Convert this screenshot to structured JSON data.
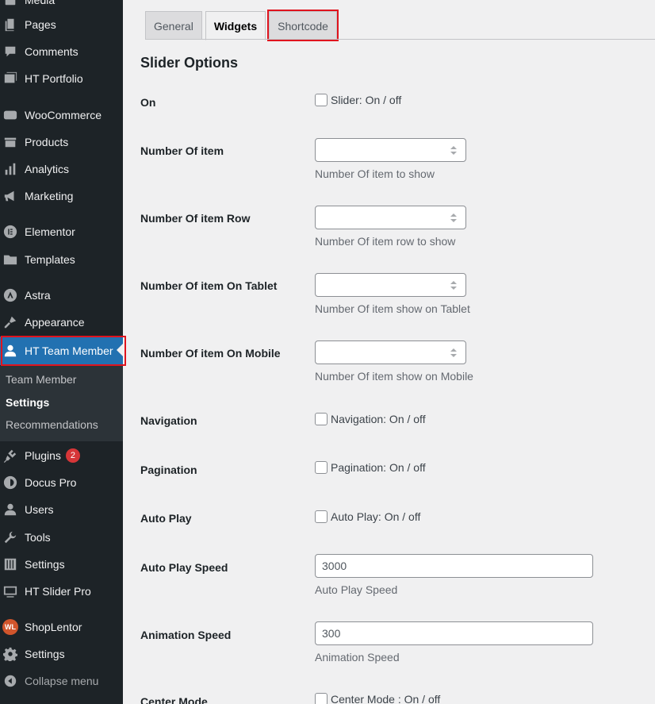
{
  "sidebar": {
    "items": [
      {
        "label": "Media",
        "icon": "media-icon"
      },
      {
        "label": "Pages",
        "icon": "pages-icon"
      },
      {
        "label": "Comments",
        "icon": "comments-icon"
      },
      {
        "label": "HT Portfolio",
        "icon": "portfolio-icon"
      },
      {
        "label": "WooCommerce",
        "icon": "woocommerce-icon"
      },
      {
        "label": "Products",
        "icon": "products-icon"
      },
      {
        "label": "Analytics",
        "icon": "analytics-icon"
      },
      {
        "label": "Marketing",
        "icon": "megaphone-icon"
      },
      {
        "label": "Elementor",
        "icon": "elementor-icon"
      },
      {
        "label": "Templates",
        "icon": "folder-icon"
      },
      {
        "label": "Astra",
        "icon": "astra-icon"
      },
      {
        "label": "Appearance",
        "icon": "brush-icon"
      },
      {
        "label": "HT Team Member",
        "icon": "user-icon"
      },
      {
        "label": "Plugins",
        "icon": "plugin-icon",
        "badge": "2"
      },
      {
        "label": "Docus Pro",
        "icon": "docus-icon"
      },
      {
        "label": "Users",
        "icon": "users-icon"
      },
      {
        "label": "Tools",
        "icon": "wrench-icon"
      },
      {
        "label": "Settings",
        "icon": "sliders-icon"
      },
      {
        "label": "HT Slider Pro",
        "icon": "slider-icon"
      },
      {
        "label": "ShopLentor",
        "icon": "shoplentor-icon",
        "logo_text": "WL"
      },
      {
        "label": "Settings",
        "icon": "gear-icon"
      },
      {
        "label": "Collapse menu",
        "icon": "collapse-icon"
      }
    ],
    "submenu": [
      {
        "label": "Team Member"
      },
      {
        "label": "Settings"
      },
      {
        "label": "Recommendations"
      }
    ]
  },
  "tabs": [
    {
      "label": "General"
    },
    {
      "label": "Widgets"
    },
    {
      "label": "Shortcode"
    }
  ],
  "section_title": "Slider Options",
  "fields": {
    "on": {
      "label": "On",
      "checkbox_label": "Slider: On / off"
    },
    "num_item": {
      "label": "Number Of item",
      "value": "",
      "desc": "Number Of item to show"
    },
    "num_row": {
      "label": "Number Of item Row",
      "value": "",
      "desc": "Number Of item row to show"
    },
    "num_tablet": {
      "label": "Number Of item On Tablet",
      "value": "",
      "desc": "Number Of item show on Tablet"
    },
    "num_mobile": {
      "label": "Number Of item On Mobile",
      "value": "",
      "desc": "Number Of item show on Mobile"
    },
    "navigation": {
      "label": "Navigation",
      "checkbox_label": "Navigation: On / off"
    },
    "pagination": {
      "label": "Pagination",
      "checkbox_label": "Pagination: On / off"
    },
    "autoplay": {
      "label": "Auto Play",
      "checkbox_label": "Auto Play: On / off"
    },
    "autoplay_speed": {
      "label": "Auto Play Speed",
      "value": "3000",
      "desc": "Auto Play Speed"
    },
    "animation_speed": {
      "label": "Animation Speed",
      "value": "300",
      "desc": "Animation Speed"
    },
    "center_mode": {
      "label": "Center Mode",
      "checkbox_label": "Center Mode : On / off"
    }
  }
}
